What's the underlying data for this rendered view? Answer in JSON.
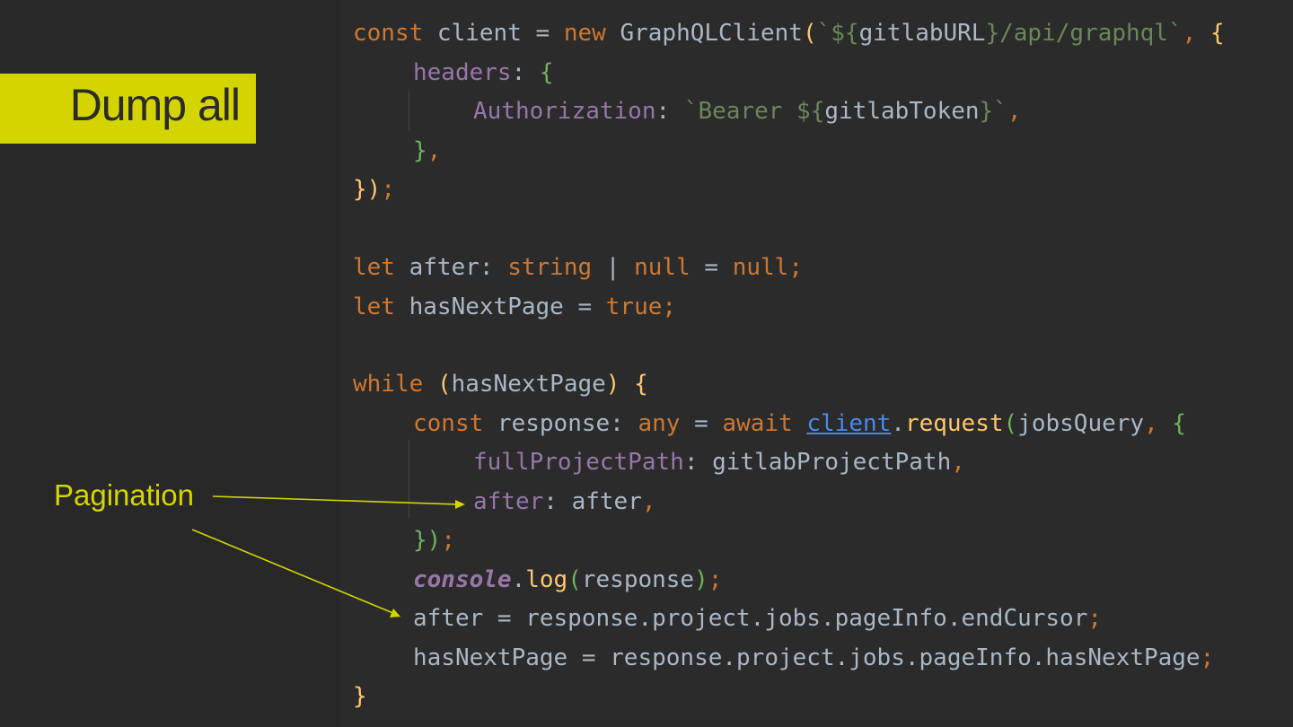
{
  "slide": {
    "title": "Dump all",
    "annotation": "Pagination"
  },
  "colors": {
    "accent": "#d4d400",
    "background": "#282828",
    "editor_background": "#2b2b2b",
    "keyword": "#cc7832",
    "identifier": "#a9b7c6",
    "property": "#9876aa",
    "string": "#6a8759",
    "function": "#ffc66d"
  },
  "code": {
    "language": "typescript",
    "lines": [
      "const client = new GraphQLClient(`${gitlabURL}/api/graphql`, {",
      "    headers: {",
      "        Authorization: `Bearer ${gitlabToken}`,",
      "    },",
      "});",
      "",
      "let after: string | null = null;",
      "let hasNextPage = true;",
      "",
      "while (hasNextPage) {",
      "    const response: any = await client.request(jobsQuery, {",
      "        fullProjectPath: gitlabProjectPath,",
      "        after: after,",
      "    });",
      "    console.log(response);",
      "    after = response.project.jobs.pageInfo.endCursor;",
      "    hasNextPage = response.project.jobs.pageInfo.hasNextPage;",
      "}"
    ],
    "tokens": {
      "l1": [
        "const",
        " client = ",
        "new",
        " GraphQLClient",
        "(",
        "`${",
        "gitlabURL",
        "}/api/graphql`",
        ", ",
        "{"
      ],
      "l2": [
        "headers",
        ": ",
        "{"
      ],
      "l3": [
        "Authorization",
        ": ",
        "`Bearer ${",
        "gitlabToken",
        "}`",
        ","
      ],
      "l4": [
        "}",
        ","
      ],
      "l5": [
        "})",
        ";"
      ],
      "l7": [
        "let",
        " after",
        ": ",
        "string",
        " | ",
        "null",
        " = ",
        "null",
        ";"
      ],
      "l8": [
        "let",
        " hasNextPage = ",
        "true",
        ";"
      ],
      "l10": [
        "while",
        " ",
        "(",
        "hasNextPage",
        ")",
        " ",
        "{"
      ],
      "l11": [
        "const",
        " response",
        ": ",
        "any",
        " = ",
        "await",
        " ",
        "client",
        ".",
        "request",
        "(",
        "jobsQuery",
        ", ",
        "{"
      ],
      "l12": [
        "fullProjectPath",
        ": ",
        "gitlabProjectPath",
        ","
      ],
      "l13": [
        "after",
        ": ",
        "after",
        ","
      ],
      "l14": [
        "}",
        ")",
        ";"
      ],
      "l15": [
        "console",
        ".",
        "log",
        "(",
        "response",
        ")",
        ";"
      ],
      "l16": [
        "after = response.project.jobs.pageInfo.endCursor",
        ";"
      ],
      "l17": [
        "hasNextPage = response.project.jobs.pageInfo.hasNextPage",
        ";"
      ],
      "l18": [
        "}"
      ]
    }
  }
}
